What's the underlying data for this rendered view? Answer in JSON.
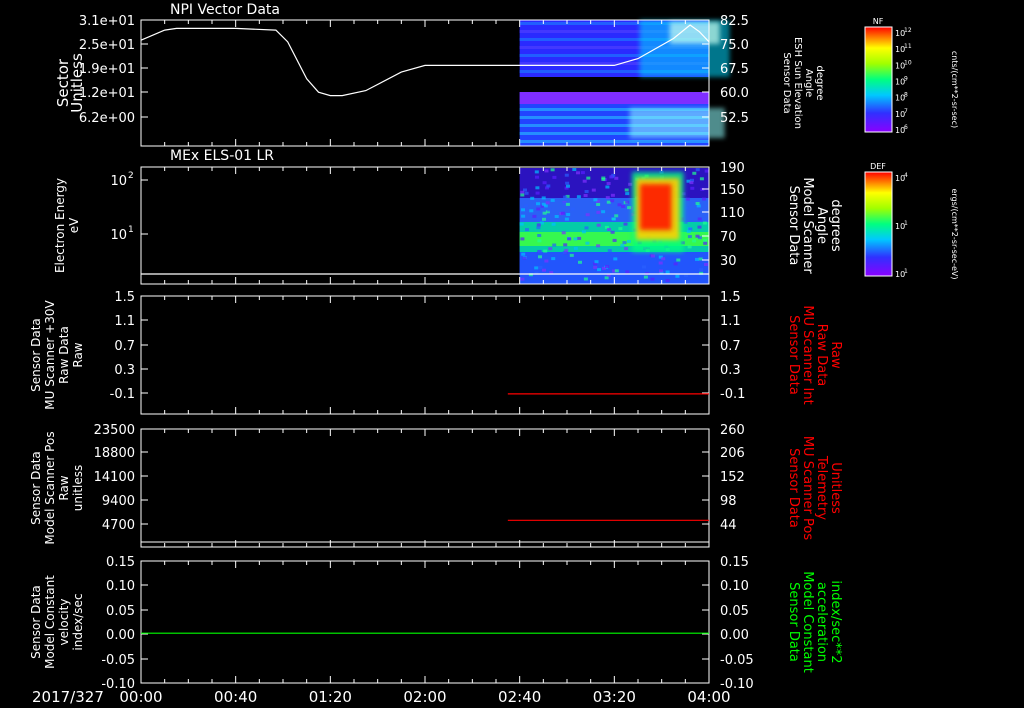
{
  "date_label": "2017/327",
  "x_ticks": [
    "00:00",
    "00:40",
    "01:20",
    "02:00",
    "02:40",
    "03:20",
    "04:00"
  ],
  "panels": [
    {
      "title": "NPI Vector Data",
      "left_label": [
        "Sector",
        "Unitless"
      ],
      "left_ticks": [
        "3.1e+01",
        "2.5e+01",
        "1.9e+01",
        "1.2e+01",
        "6.2e+00"
      ],
      "right_label": [
        "Sensor Data",
        "ESH Sun Elevation",
        "Angle",
        "degree"
      ],
      "right_ticks": [
        "82.5",
        "75.0",
        "67.5",
        "60.0",
        "52.5"
      ],
      "right_label_color": "#ffffff"
    },
    {
      "title": "MEx ELS-01 LR",
      "left_label": [
        "Electron Energy",
        "eV"
      ],
      "left_ticks": [
        "10",
        "10"
      ],
      "left_tick_exponents": [
        "2",
        "1"
      ],
      "right_label": [
        "Sensor Data",
        "Model Scanner",
        "Angle",
        "degrees"
      ],
      "right_ticks": [
        "190",
        "150",
        "110",
        "70",
        "30"
      ],
      "right_label_color": "#ffffff"
    },
    {
      "title": "",
      "left_label": [
        "Sensor Data",
        "MU Scanner +30V",
        "Raw Data",
        "Raw"
      ],
      "left_ticks": [
        "1.5",
        "1.1",
        "0.7",
        "0.3",
        "-0.1"
      ],
      "right_label": [
        "Sensor Data",
        "MU Scanner Int",
        "Raw Data",
        "Raw"
      ],
      "right_ticks": [
        "1.5",
        "1.1",
        "0.7",
        "0.3",
        "-0.1"
      ],
      "right_label_color": "#ff0000"
    },
    {
      "title": "",
      "left_label": [
        "Sensor Data",
        "Model Scanner Pos",
        "Raw",
        "unitless"
      ],
      "left_ticks": [
        "23500",
        "18800",
        "14100",
        "9400",
        "4700"
      ],
      "right_label": [
        "Sensor Data",
        "MU Scanner Pos",
        "Telemetry",
        "Unitless"
      ],
      "right_ticks": [
        "260",
        "206",
        "152",
        "98",
        "44"
      ],
      "right_label_color": "#ff0000"
    },
    {
      "title": "",
      "left_label": [
        "Sensor Data",
        "Model Constant",
        "velocity",
        "index/sec"
      ],
      "left_ticks": [
        "0.15",
        "0.10",
        "0.05",
        "0.00",
        "-0.05",
        "-0.10"
      ],
      "right_label": [
        "Sensor Data",
        "Model Constant",
        "acceleration",
        "index/sec**2"
      ],
      "right_ticks": [
        "0.15",
        "0.10",
        "0.05",
        "0.00",
        "-0.05",
        "-0.10"
      ],
      "right_label_color": "#00ff00"
    }
  ],
  "colorbars": [
    {
      "title": "NF",
      "unit": "cnts/(cm**2-sr-sec)",
      "tick_base": "10",
      "tick_exponents": [
        "12",
        "11",
        "10",
        "9",
        "8",
        "7",
        "6"
      ]
    },
    {
      "title": "DEF",
      "unit": "ergs/(cm**2-sr-sec-eV)",
      "tick_base": "10",
      "tick_exponents": [
        "4",
        "1",
        "1"
      ]
    }
  ],
  "chart_data": [
    {
      "type": "line",
      "title": "NPI Vector Data",
      "x_unit": "time (hh:mm)",
      "xlim": [
        "00:00",
        "04:00"
      ],
      "series": [
        {
          "name": "ESH Sun Elevation Angle",
          "axis": "right",
          "color": "#ffffff",
          "x": [
            "00:00",
            "00:10",
            "00:15",
            "00:20",
            "00:40",
            "00:57",
            "01:02",
            "01:10",
            "01:15",
            "01:20",
            "01:25",
            "01:35",
            "01:50",
            "02:00",
            "02:40",
            "03:20",
            "03:30",
            "03:45",
            "03:52",
            "03:56",
            "04:00"
          ],
          "y": [
            76.5,
            79.5,
            80.0,
            80.0,
            80.0,
            79.5,
            76,
            65,
            61.0,
            60.0,
            60.0,
            61.5,
            67.0,
            69.0,
            69.0,
            69.0,
            71,
            77,
            81.0,
            79,
            76.0
          ]
        }
      ],
      "heatmap": {
        "x_start": "02:40",
        "x_end": "04:00",
        "y_bands": [
          "6.2e+00-1.2e+01",
          "1.9e+01-3.1e+01"
        ],
        "colorbar": "NF"
      },
      "left_ylim": [
        0,
        31
      ],
      "right_ylim": [
        45,
        82.5
      ]
    },
    {
      "type": "heatmap",
      "title": "MEx ELS-01 LR",
      "x_unit": "time (hh:mm)",
      "xlim": [
        "00:00",
        "04:00"
      ],
      "data_start": "02:40",
      "ylog": true,
      "ylim": [
        1,
        200
      ],
      "peak_region": {
        "x": [
          "03:30",
          "03:45"
        ],
        "energy_eV": [
          20,
          150
        ]
      },
      "colorbar": "DEF",
      "series": [
        {
          "name": "Model Scanner Angle",
          "axis": "right",
          "color": "#ffffff",
          "x": [
            "00:00",
            "04:00"
          ],
          "y": [
            10,
            10
          ]
        }
      ],
      "right_ylim": [
        10,
        190
      ]
    },
    {
      "type": "line",
      "xlim": [
        "00:00",
        "04:00"
      ],
      "left_ylim": [
        -0.3,
        1.5
      ],
      "right_ylim": [
        -0.3,
        1.5
      ],
      "series": [
        {
          "name": "MU Scanner Int Raw Data",
          "axis": "right",
          "color": "#ff0000",
          "x": [
            "02:35",
            "04:00"
          ],
          "y": [
            -0.1,
            -0.1
          ]
        }
      ]
    },
    {
      "type": "line",
      "xlim": [
        "00:00",
        "04:00"
      ],
      "left_ylim": [
        0,
        23500
      ],
      "right_ylim": [
        17,
        260
      ],
      "series": [
        {
          "name": "MU Scanner Pos Telemetry",
          "axis": "right",
          "color": "#ff0000",
          "x": [
            "02:35",
            "04:00"
          ],
          "y": [
            72,
            72
          ]
        }
      ]
    },
    {
      "type": "line",
      "xlim": [
        "00:00",
        "04:00"
      ],
      "left_ylim": [
        -0.1,
        0.15
      ],
      "right_ylim": [
        -0.1,
        0.15
      ],
      "series": [
        {
          "name": "Model Constant velocity",
          "axis": "left",
          "color": "#00ff00",
          "x": [
            "00:00",
            "04:00"
          ],
          "y": [
            0.0,
            0.0
          ]
        }
      ]
    }
  ]
}
